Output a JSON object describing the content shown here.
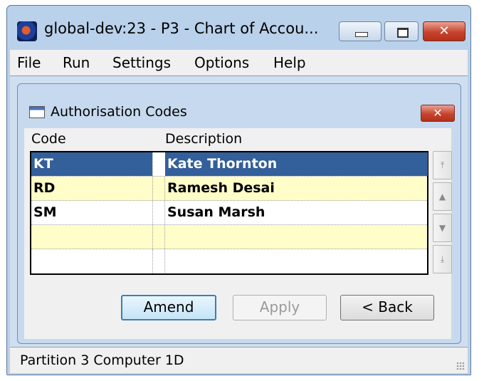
{
  "window": {
    "title": "global-dev:23 - P3 - Chart of Accou...",
    "icons": {
      "app": "app-globe-icon",
      "minimize": "minimize-icon",
      "maximize": "maximize-icon",
      "close": "close-icon"
    },
    "close_glyph": "✕"
  },
  "menubar": {
    "items": [
      {
        "label": "File"
      },
      {
        "label": "Run"
      },
      {
        "label": "Settings"
      },
      {
        "label": "Options"
      },
      {
        "label": "Help"
      }
    ]
  },
  "dialog": {
    "title": "Authorisation Codes",
    "icon": "window-icon",
    "close_glyph": "✕",
    "columns": {
      "code": "Code",
      "description": "Description"
    },
    "rows": [
      {
        "code": "KT",
        "description": "Kate Thornton",
        "selected": true
      },
      {
        "code": "RD",
        "description": "Ramesh Desai",
        "selected": false
      },
      {
        "code": "SM",
        "description": "Susan Marsh",
        "selected": false
      },
      {
        "code": "",
        "description": "",
        "selected": false
      },
      {
        "code": "",
        "description": "",
        "selected": false
      }
    ],
    "scroll": {
      "top": "⤒",
      "up": "▲",
      "down": "▼",
      "bottom": "⤓"
    },
    "buttons": {
      "amend": "Amend",
      "apply": "Apply",
      "back": "< Back"
    },
    "colors": {
      "selection": "#335f9a",
      "alt_row": "#fffdc8"
    }
  },
  "statusbar": {
    "text": "Partition 3 Computer 1D"
  }
}
